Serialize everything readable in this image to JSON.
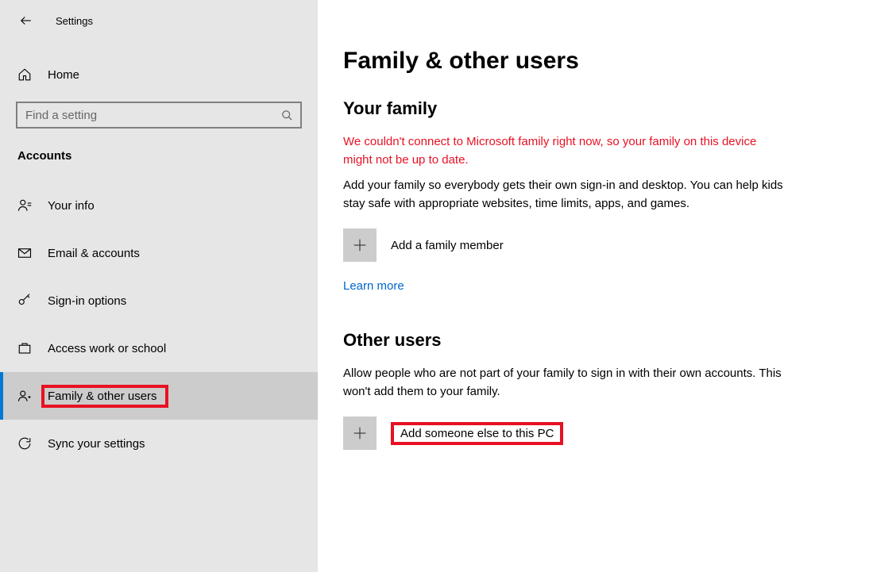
{
  "header": {
    "title": "Settings"
  },
  "sidebar": {
    "home": "Home",
    "search_placeholder": "Find a setting",
    "section": "Accounts",
    "items": [
      {
        "label": "Your info"
      },
      {
        "label": "Email & accounts"
      },
      {
        "label": "Sign-in options"
      },
      {
        "label": "Access work or school"
      },
      {
        "label": "Family & other users"
      },
      {
        "label": "Sync your settings"
      }
    ]
  },
  "main": {
    "title": "Family & other users",
    "family": {
      "heading": "Your family",
      "error": "We couldn't connect to Microsoft family right now, so your family on this device might not be up to date.",
      "description": "Add your family so everybody gets their own sign-in and desktop. You can help kids stay safe with appropriate websites, time limits, apps, and games.",
      "add_label": "Add a family member",
      "learn_more": "Learn more"
    },
    "other": {
      "heading": "Other users",
      "description": "Allow people who are not part of your family to sign in with their own accounts. This won't add them to your family.",
      "add_label": "Add someone else to this PC"
    }
  }
}
